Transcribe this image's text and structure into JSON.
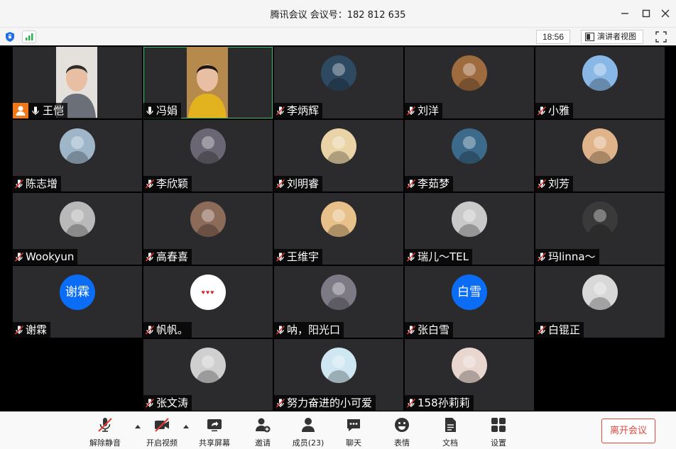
{
  "window": {
    "title": "腾讯会议  会议号：182 812 635"
  },
  "infobar": {
    "time": "18:56",
    "presenter_view": "演讲者视图"
  },
  "participants": [
    {
      "name": "王恺",
      "host": true,
      "mic": "on",
      "media": "video"
    },
    {
      "name": "冯娟",
      "host": false,
      "mic": "on",
      "media": "video",
      "active": true
    },
    {
      "name": "李炳辉",
      "mic": "off",
      "media": "avatar",
      "avatar_color": "#2e4a63"
    },
    {
      "name": "刘洋",
      "mic": "off",
      "media": "avatar",
      "avatar_color": "#9e6b3f"
    },
    {
      "name": "小雅",
      "mic": "off",
      "media": "avatar",
      "avatar_color": "#8ab8e6"
    },
    {
      "name": "陈志增",
      "mic": "off",
      "media": "avatar",
      "avatar_color": "#9fb6c9"
    },
    {
      "name": "李欣颖",
      "mic": "off",
      "media": "avatar",
      "avatar_color": "#6b6673"
    },
    {
      "name": "刘明睿",
      "mic": "off",
      "media": "avatar",
      "avatar_color": "#e9d3a7"
    },
    {
      "name": "李茹梦",
      "mic": "off",
      "media": "avatar",
      "avatar_color": "#3c6a8a"
    },
    {
      "name": "刘芳",
      "mic": "off",
      "media": "avatar",
      "avatar_color": "#e0b48a"
    },
    {
      "name": "Wookyun",
      "mic": "off",
      "media": "avatar",
      "avatar_color": "#b9b9b9"
    },
    {
      "name": "高春喜",
      "mic": "off",
      "media": "avatar",
      "avatar_color": "#8c6b59"
    },
    {
      "name": "王维宇",
      "mic": "off",
      "media": "avatar",
      "avatar_color": "#e8c08a"
    },
    {
      "name": "瑞儿～TEL",
      "mic": "off",
      "media": "avatar",
      "avatar_color": "#c9c9c9"
    },
    {
      "name": "玛linna～",
      "mic": "off",
      "media": "avatar",
      "avatar_color": "#3a3a3a"
    },
    {
      "name": "谢霖",
      "mic": "off",
      "media": "text",
      "avatar_text": "谢霖"
    },
    {
      "name": "帆帆。",
      "mic": "off",
      "media": "dots",
      "avatar_text": "♥♥♥"
    },
    {
      "name": "呐，阳光口",
      "mic": "off",
      "media": "avatar",
      "avatar_color": "#7d7a86"
    },
    {
      "name": "张白雪",
      "mic": "off",
      "media": "text",
      "avatar_text": "白雪"
    },
    {
      "name": "白锟正",
      "mic": "off",
      "media": "avatar",
      "avatar_color": "#d8d8d8"
    },
    {
      "name": "张文涛",
      "mic": "off",
      "media": "avatar",
      "avatar_color": "#cfcfcf"
    },
    {
      "name": "努力奋进的小可爱",
      "mic": "off",
      "media": "avatar",
      "avatar_color": "#cfe7f2"
    },
    {
      "name": "158孙莉莉",
      "mic": "off",
      "media": "avatar",
      "avatar_color": "#e8d6cf"
    }
  ],
  "toolbar": {
    "unmute": "解除静音",
    "start_video": "开启视频",
    "share_screen": "共享屏幕",
    "invite": "邀请",
    "members": "成员(23)",
    "chat": "聊天",
    "reactions": "表情",
    "docs": "文档",
    "settings": "设置",
    "leave": "离开会议"
  },
  "colors": {
    "tile_bg": "#2b2b2d",
    "active_border": "#3fc06a",
    "host_badge": "#f07818",
    "leave_red": "#e2483c",
    "avatar_blue": "#0b6cf5"
  }
}
